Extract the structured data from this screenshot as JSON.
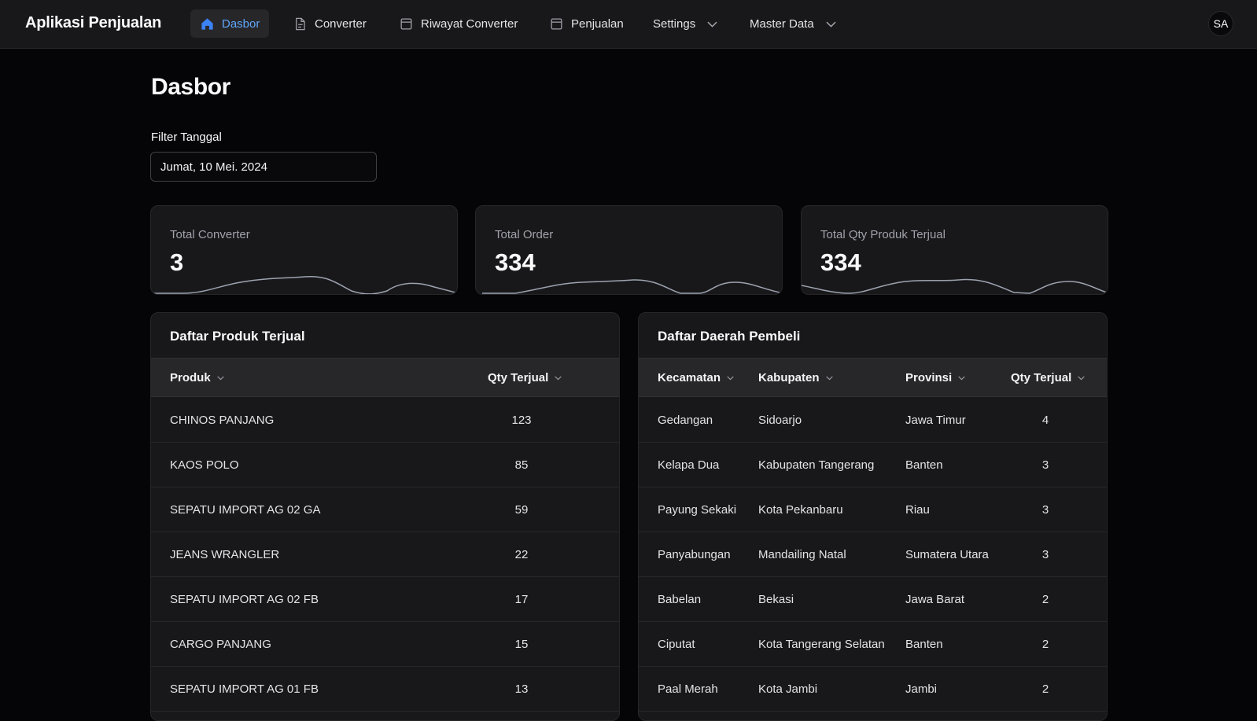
{
  "app": {
    "title": "Aplikasi Penjualan",
    "user_initials": "SA"
  },
  "nav": {
    "dasbor": "Dasbor",
    "converter": "Converter",
    "riwayat": "Riwayat Converter",
    "penjualan": "Penjualan",
    "settings": "Settings",
    "master": "Master Data"
  },
  "page": {
    "title": "Dasbor",
    "filter_label": "Filter Tanggal",
    "filter_value": "Jumat, 10 Mei. 2024"
  },
  "stats": [
    {
      "label": "Total Converter",
      "value": "3"
    },
    {
      "label": "Total Order",
      "value": "334"
    },
    {
      "label": "Total Qty Produk Terjual",
      "value": "334"
    }
  ],
  "products": {
    "title": "Daftar Produk Terjual",
    "col_produk": "Produk",
    "col_qty": "Qty Terjual",
    "rows": [
      {
        "name": "CHINOS PANJANG",
        "qty": "123"
      },
      {
        "name": "KAOS POLO",
        "qty": "85"
      },
      {
        "name": "SEPATU IMPORT AG 02 GA",
        "qty": "59"
      },
      {
        "name": "JEANS WRANGLER",
        "qty": "22"
      },
      {
        "name": "SEPATU IMPORT AG 02 FB",
        "qty": "17"
      },
      {
        "name": "CARGO PANJANG",
        "qty": "15"
      },
      {
        "name": "SEPATU IMPORT AG 01 FB",
        "qty": "13"
      }
    ]
  },
  "regions": {
    "title": "Daftar Daerah Pembeli",
    "col_kecamatan": "Kecamatan",
    "col_kabupaten": "Kabupaten",
    "col_provinsi": "Provinsi",
    "col_qty": "Qty Terjual",
    "rows": [
      {
        "kec": "Gedangan",
        "kab": "Sidoarjo",
        "prov": "Jawa Timur",
        "qty": "4"
      },
      {
        "kec": "Kelapa Dua",
        "kab": "Kabupaten Tangerang",
        "prov": "Banten",
        "qty": "3"
      },
      {
        "kec": "Payung Sekaki",
        "kab": "Kota Pekanbaru",
        "prov": "Riau",
        "qty": "3"
      },
      {
        "kec": "Panyabungan",
        "kab": "Mandailing Natal",
        "prov": "Sumatera Utara",
        "qty": "3"
      },
      {
        "kec": "Babelan",
        "kab": "Bekasi",
        "prov": "Jawa Barat",
        "qty": "2"
      },
      {
        "kec": "Ciputat",
        "kab": "Kota Tangerang Selatan",
        "prov": "Banten",
        "qty": "2"
      },
      {
        "kec": "Paal Merah",
        "kab": "Kota Jambi",
        "prov": "Jambi",
        "qty": "2"
      }
    ]
  }
}
